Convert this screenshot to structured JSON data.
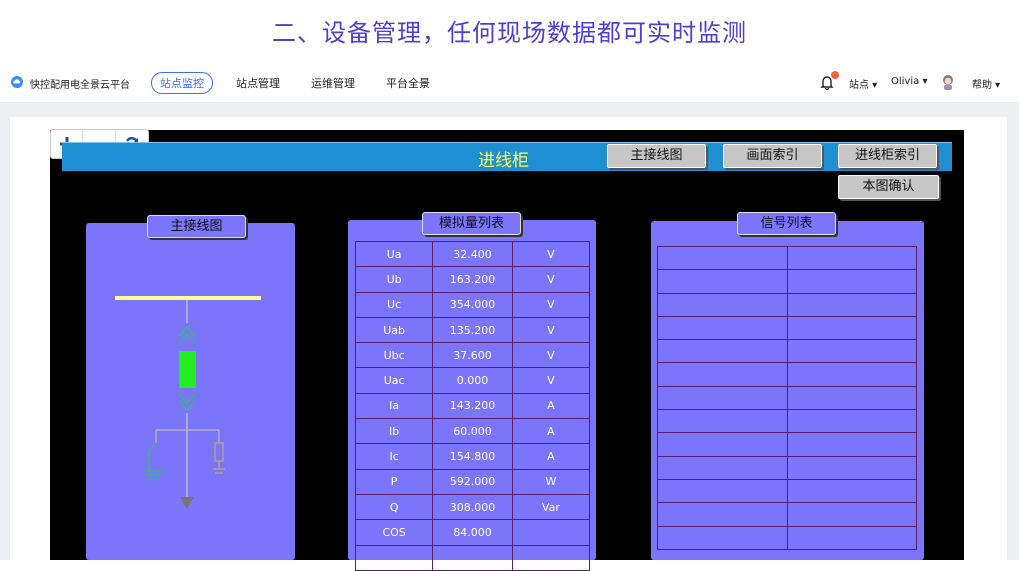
{
  "banner": {
    "title": "二、设备管理，任何现场数据都可实时监测"
  },
  "nav": {
    "brand": "快控配用电全景云平台",
    "items": [
      {
        "label": "站点监控",
        "active": true
      },
      {
        "label": "站点管理",
        "active": false
      },
      {
        "label": "运维管理",
        "active": false
      },
      {
        "label": "平台全景",
        "active": false
      }
    ],
    "station": "站点",
    "user": "Olivia",
    "help": "帮助"
  },
  "screen": {
    "title": "进线柜",
    "buttons": {
      "main_diagram": "主接线图",
      "index": "画面索引",
      "cabinet_index": "进线柜索引",
      "confirm": "本图确认"
    },
    "panels": {
      "diagram": "主接线图",
      "analog": "模拟量列表",
      "signal": "信号列表"
    }
  },
  "analog_rows": [
    {
      "name": "Ua",
      "value": "32.400",
      "unit": "V"
    },
    {
      "name": "Ub",
      "value": "163.200",
      "unit": "V"
    },
    {
      "name": "Uc",
      "value": "354.000",
      "unit": "V"
    },
    {
      "name": "Uab",
      "value": "135.200",
      "unit": "V"
    },
    {
      "name": "Ubc",
      "value": "37.600",
      "unit": "V"
    },
    {
      "name": "Uac",
      "value": "0.000",
      "unit": "V"
    },
    {
      "name": "Ia",
      "value": "143.200",
      "unit": "A"
    },
    {
      "name": "Ib",
      "value": "60.000",
      "unit": "A"
    },
    {
      "name": "Ic",
      "value": "154.800",
      "unit": "A"
    },
    {
      "name": "P",
      "value": "592.000",
      "unit": "W"
    },
    {
      "name": "Q",
      "value": "308.000",
      "unit": "Var"
    },
    {
      "name": "COS",
      "value": "84.000",
      "unit": ""
    },
    {
      "name": "",
      "value": "",
      "unit": ""
    }
  ],
  "signal_row_count": 13,
  "colors": {
    "accent": "#3e6cff",
    "panel": "#7b75fb",
    "titlebar": "#1f8fd4",
    "title_text": "#ffff55",
    "breaker": "#22ee22"
  },
  "icons": [
    "cloud-icon",
    "bell-icon",
    "avatar-icon",
    "zoom-in-icon",
    "zoom-out-icon",
    "refresh-icon"
  ]
}
